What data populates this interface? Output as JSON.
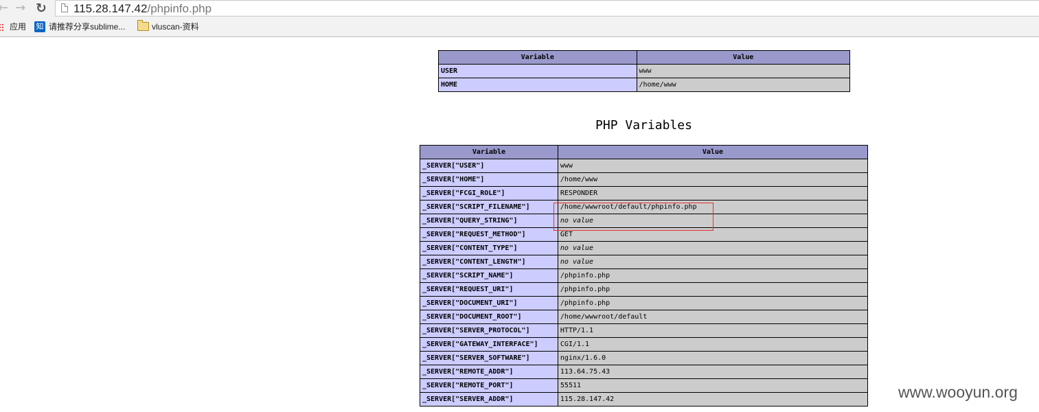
{
  "browser": {
    "url_host": "115.28.147.42",
    "url_path": "/phpinfo.php",
    "back_icon": "arrow-left-icon",
    "forward_icon": "arrow-right-icon",
    "reload_icon": "reload-icon",
    "bookmarks": [
      {
        "label": "应用",
        "icon": "apps-grid-icon"
      },
      {
        "label": "请推荐分享sublime...",
        "icon": "zhihu-icon",
        "icon_text": "知"
      },
      {
        "label": "vluscan-资料",
        "icon": "folder-icon"
      }
    ]
  },
  "env_table": {
    "headers": [
      "Variable",
      "Value"
    ],
    "rows": [
      {
        "name": "USER",
        "value": "www"
      },
      {
        "name": "HOME",
        "value": "/home/www"
      }
    ]
  },
  "php_variables": {
    "title": "PHP Variables",
    "headers": [
      "Variable",
      "Value"
    ],
    "rows": [
      {
        "name": "_SERVER[\"USER\"]",
        "value": "www"
      },
      {
        "name": "_SERVER[\"HOME\"]",
        "value": "/home/www"
      },
      {
        "name": "_SERVER[\"FCGI_ROLE\"]",
        "value": "RESPONDER"
      },
      {
        "name": "_SERVER[\"SCRIPT_FILENAME\"]",
        "value": "/home/wwwroot/default/phpinfo.php"
      },
      {
        "name": "_SERVER[\"QUERY_STRING\"]",
        "value": "no value",
        "no_value": true
      },
      {
        "name": "_SERVER[\"REQUEST_METHOD\"]",
        "value": "GET"
      },
      {
        "name": "_SERVER[\"CONTENT_TYPE\"]",
        "value": "no value",
        "no_value": true
      },
      {
        "name": "_SERVER[\"CONTENT_LENGTH\"]",
        "value": "no value",
        "no_value": true
      },
      {
        "name": "_SERVER[\"SCRIPT_NAME\"]",
        "value": "/phpinfo.php"
      },
      {
        "name": "_SERVER[\"REQUEST_URI\"]",
        "value": "/phpinfo.php"
      },
      {
        "name": "_SERVER[\"DOCUMENT_URI\"]",
        "value": "/phpinfo.php"
      },
      {
        "name": "_SERVER[\"DOCUMENT_ROOT\"]",
        "value": "/home/wwwroot/default"
      },
      {
        "name": "_SERVER[\"SERVER_PROTOCOL\"]",
        "value": "HTTP/1.1"
      },
      {
        "name": "_SERVER[\"GATEWAY_INTERFACE\"]",
        "value": "CGI/1.1"
      },
      {
        "name": "_SERVER[\"SERVER_SOFTWARE\"]",
        "value": "nginx/1.6.0"
      },
      {
        "name": "_SERVER[\"REMOTE_ADDR\"]",
        "value": "113.64.75.43"
      },
      {
        "name": "_SERVER[\"REMOTE_PORT\"]",
        "value": "55511"
      },
      {
        "name": "_SERVER[\"SERVER_ADDR\"]",
        "value": "115.28.147.42"
      }
    ]
  },
  "colors": {
    "header_bg": "#9999cc",
    "name_cell_bg": "#ccccff",
    "value_cell_bg": "#cccccc",
    "highlight_border": "#e03030"
  },
  "watermark": "www.wooyun.org"
}
